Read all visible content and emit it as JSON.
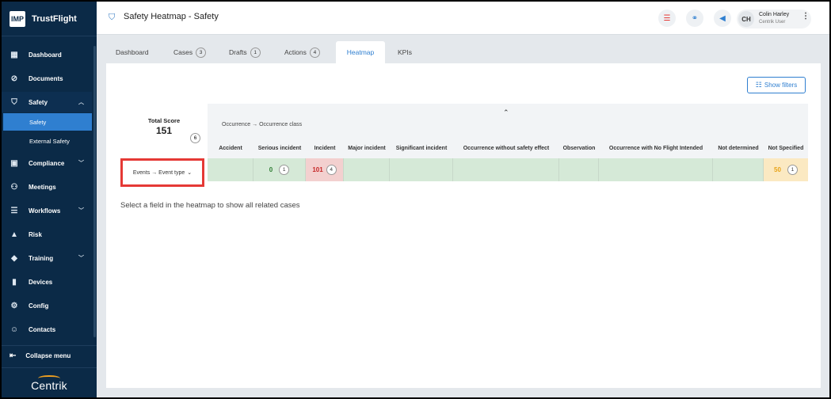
{
  "brand": {
    "logo": "IMP",
    "name": "TrustFlight",
    "footer": "Centrik"
  },
  "sidebar": {
    "items": [
      {
        "label": "Dashboard",
        "icon": "dashboard-icon",
        "glyph": "▦"
      },
      {
        "label": "Documents",
        "icon": "paperclip-icon",
        "glyph": "⊘"
      },
      {
        "label": "Safety",
        "icon": "shield-icon",
        "glyph": "⛉",
        "expanded": true
      },
      {
        "label": "Compliance",
        "icon": "compliance-icon",
        "glyph": "▣",
        "chevron": true
      },
      {
        "label": "Meetings",
        "icon": "meetings-icon",
        "glyph": "⚇"
      },
      {
        "label": "Workflows",
        "icon": "workflows-icon",
        "glyph": "☰",
        "chevron": true
      },
      {
        "label": "Risk",
        "icon": "risk-icon",
        "glyph": "▲"
      },
      {
        "label": "Training",
        "icon": "graduation-cap-icon",
        "glyph": "◆",
        "chevron": true
      },
      {
        "label": "Devices",
        "icon": "devices-icon",
        "glyph": "▮"
      },
      {
        "label": "Config",
        "icon": "config-icon",
        "glyph": "⚙"
      },
      {
        "label": "Contacts",
        "icon": "contacts-icon",
        "glyph": "☺"
      }
    ],
    "safety_sub": [
      "Safety",
      "External Safety"
    ],
    "collapse_label": "Collapse menu"
  },
  "header": {
    "title": "Safety Heatmap  - Safety",
    "user_initials": "CH",
    "user_name": "Colin Harley",
    "user_role": "Centrik User"
  },
  "tabs": [
    {
      "label": "Dashboard",
      "count": null
    },
    {
      "label": "Cases",
      "count": "3"
    },
    {
      "label": "Drafts",
      "count": "1"
    },
    {
      "label": "Actions",
      "count": "4"
    },
    {
      "label": "Heatmap",
      "count": null,
      "active": true
    },
    {
      "label": "KPIs",
      "count": null
    }
  ],
  "heatmap": {
    "filters_label": "Show filters",
    "total_score_label": "Total Score",
    "total_score": "151",
    "total_count": "6",
    "column_group": "Occurrence → Occurrence class",
    "row_group": "Events → Event type",
    "columns": [
      "Accident",
      "Serious incident",
      "Incident",
      "Major incident",
      "Significant incident",
      "Occurrence without safety effect",
      "Observation",
      "Occurrence with No Flight Intended",
      "Not determined",
      "Not Specified"
    ],
    "row": [
      {
        "value": "",
        "count": ""
      },
      {
        "value": "0",
        "count": "1"
      },
      {
        "value": "101",
        "count": "4"
      },
      {
        "value": "",
        "count": ""
      },
      {
        "value": "",
        "count": ""
      },
      {
        "value": "",
        "count": ""
      },
      {
        "value": "",
        "count": ""
      },
      {
        "value": "",
        "count": ""
      },
      {
        "value": "",
        "count": ""
      },
      {
        "value": "50",
        "count": "1"
      }
    ],
    "hint": "Select a field in the heatmap to show all related cases"
  },
  "colors": {
    "green_cell": "#d5e9d7",
    "red_cell": "#f3d0cf",
    "yellow_cell": "#fbe9c2",
    "accent": "#2f7fd0",
    "sidebar": "#0b2a47"
  }
}
